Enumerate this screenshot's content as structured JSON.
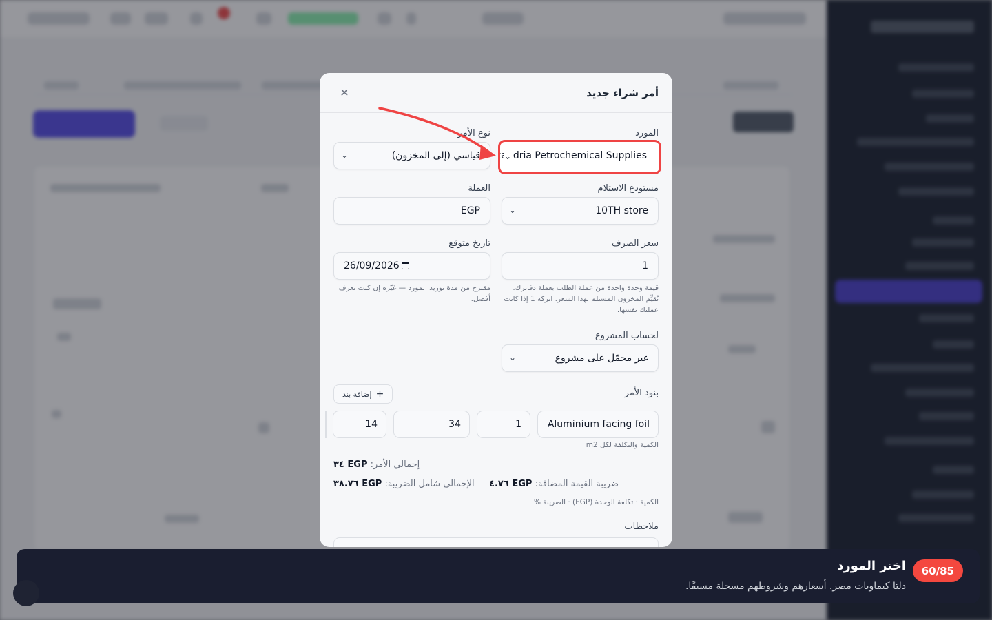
{
  "modal": {
    "title": "أمر شراء جديد",
    "close_glyph": "✕",
    "supplier": {
      "label": "المورد",
      "value": "Alexandria Petrochemical Supplies"
    },
    "order_type": {
      "label": "نوع الأمر",
      "value": "قياسي (إلى المخزون)"
    },
    "warehouse": {
      "label": "مستودع الاستلام",
      "value": "10TH store"
    },
    "currency": {
      "label": "العملة",
      "value": "EGP"
    },
    "exchange_rate": {
      "label": "سعر الصرف",
      "value": "1",
      "help": "قيمة وحدة واحدة من عملة الطلب بعملة دفاترك. تُقيِّم المخزون المستلم بهذا السعر. اتركه 1 إذا كانت عملتك نفسها."
    },
    "expected_date": {
      "label": "تاريخ متوقع",
      "value": "26/09/2026",
      "help": "مقترح من مدة توريد المورد — غيّره إن كنت تعرف أفضل."
    },
    "project": {
      "label": "لحساب المشروع",
      "value": "غير محمّل على مشروع"
    },
    "lines": {
      "label": "بنود الأمر",
      "add_button": "إضافة بند",
      "item": "Aluminium facing foil",
      "quantity": "1",
      "unit_cost": "34",
      "tax": "14",
      "unit_note": "الكمية والتكلفة لكل m2"
    },
    "totals": {
      "order_total_label": "إجمالي الأمر:",
      "order_total_value": "EGP ٣٤",
      "vat_label": "ضريبة القيمة المضافة:",
      "vat_value": "EGP ٤.٧٦",
      "grand_total_label": "الإجمالي شامل الضريبة:",
      "grand_total_value": "EGP ٣٨.٧٦",
      "columns_note": "الكمية · تكلفة الوحدة (EGP) · الضريبة %"
    },
    "notes_label": "ملاحظات"
  },
  "tour": {
    "counter": "60/85",
    "title": "اختر المورد",
    "description": "دلتا كيماويات مصر. أسعارهم وشروطهم مسجلة مسبقًا."
  },
  "colors": {
    "highlight": "#ef4444",
    "tour_bg": "#1a1e30",
    "counter_bg": "#f4483f",
    "primary": "#4f46e5"
  }
}
